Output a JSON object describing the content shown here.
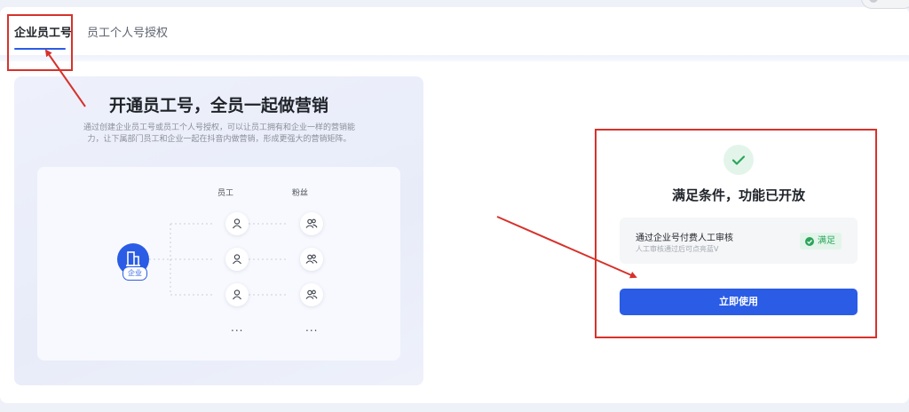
{
  "tabs": [
    {
      "label": "企业员工号",
      "active": true
    },
    {
      "label": "员工个人号授权",
      "active": false
    }
  ],
  "promo": {
    "title": "开通员工号，全员一起做营销",
    "description": "通过创建企业员工号或员工个人号授权，可以让员工拥有和企业一样的营销能力，让下属部门员工和企业一起在抖音内做营销，形成更强大的营销矩阵。"
  },
  "diagram": {
    "company_label": "企业",
    "employee_header": "员工",
    "fans_header": "粉丝",
    "ellipsis": "..."
  },
  "status": {
    "title": "满足条件，功能已开放",
    "condition_title": "通过企业号付费人工审核",
    "condition_subtitle": "人工审核通过后可点亮蓝V",
    "condition_badge": "满足",
    "button_label": "立即使用"
  },
  "colors": {
    "accent": "#2b5ce6",
    "success": "#2aa55a",
    "success_bg": "#e3f5ea",
    "annotation": "#d6322b"
  },
  "icons": [
    "company-building-icon",
    "person-icon",
    "people-icon",
    "check-icon",
    "check-circle-icon"
  ]
}
